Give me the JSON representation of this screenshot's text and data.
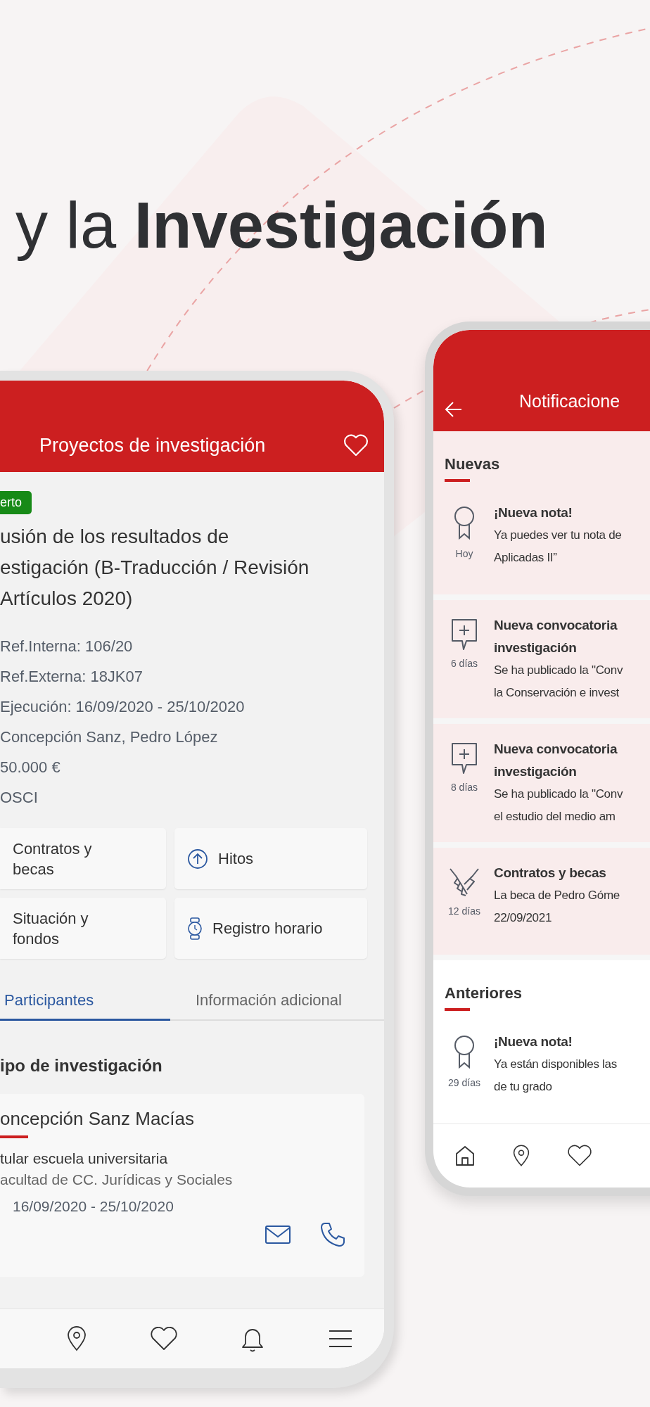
{
  "headline": "y la **Investigación**",
  "project_screen": {
    "title": "Proyectos de investigación",
    "badge": "erto",
    "project_title": [
      "usión de los resultados de",
      "estigación (B-Traducción / Revisión",
      "Artículos 2020)"
    ],
    "details": [
      "Ref.Interna: 106/20",
      "Ref.Externa: 18JK07",
      "Ejecución: 16/09/2020 - 25/10/2020",
      "Concepción Sanz, Pedro López",
      "50.000 €",
      "OSCI"
    ],
    "shortcuts": [
      {
        "label": "Contratos y becas",
        "kind": "cut"
      },
      {
        "label": "Hitos",
        "kind": "milestone"
      },
      {
        "label": "Situación y fondos",
        "kind": "plain"
      },
      {
        "label": "Registro horario",
        "kind": "watch"
      }
    ],
    "tabs": [
      {
        "label": "Participantes",
        "selected": true
      },
      {
        "label": "Información adicional",
        "selected": false
      }
    ],
    "section_title": "ipo de investigación",
    "participant": {
      "name": "oncepción Sanz Macías",
      "role": "tular escuela universitaria",
      "faculty": "acultad de CC. Jurídicas y Sociales",
      "dates": "16/09/2020 - 25/10/2020"
    }
  },
  "notifications_screen": {
    "title": "Notificacione",
    "sections": [
      {
        "title": "Nuevas",
        "highlighted": true,
        "items": [
          {
            "kind": "award",
            "title": [
              "¡Nueva nota!"
            ],
            "age": "Hoy",
            "text": [
              "Ya puedes ver tu nota de",
              "Aplicadas II”"
            ]
          },
          {
            "kind": "comment",
            "title": [
              "Nueva convocatoria",
              "investigación"
            ],
            "age": "6 días",
            "text": [
              "Se ha publicado la \"Conv",
              "la Conservación e invest"
            ]
          },
          {
            "kind": "comment",
            "title": [
              "Nueva convocatoria",
              "investigación"
            ],
            "age": "8 días",
            "text": [
              "Se ha publicado la \"Conv",
              "el estudio del medio am"
            ]
          },
          {
            "kind": "handshake",
            "title": [
              "Contratos y becas"
            ],
            "age": "12 días",
            "text": [
              "La beca de Pedro Góme",
              "22/09/2021"
            ]
          }
        ]
      },
      {
        "title": "Anteriores",
        "highlighted": false,
        "items": [
          {
            "kind": "award",
            "title": [
              "¡Nueva nota!"
            ],
            "age": "29 días",
            "text": [
              "Ya están disponibles las",
              "de tu grado"
            ]
          }
        ]
      }
    ]
  }
}
